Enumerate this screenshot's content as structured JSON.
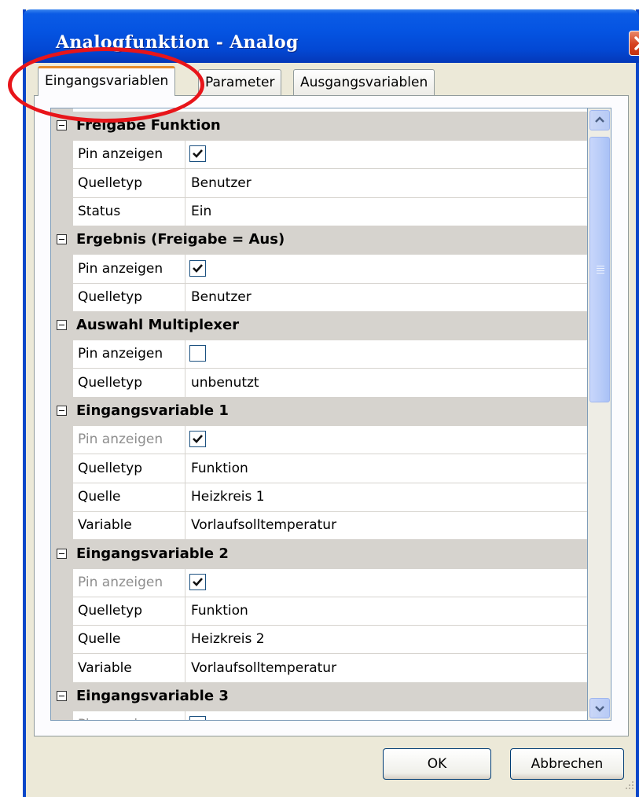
{
  "window": {
    "title": "Analogfunktion - Analog"
  },
  "tabs": [
    {
      "label": "Eingangsvariablen",
      "active": true
    },
    {
      "label": "Parameter",
      "active": false
    },
    {
      "label": "Ausgangsvariablen",
      "active": false
    }
  ],
  "grid": {
    "categories": [
      {
        "label": "Freigabe Funktion",
        "rows": [
          {
            "name": "Pin anzeigen",
            "checkbox": true,
            "checked": true
          },
          {
            "name": "Quelletyp",
            "value": "Benutzer"
          },
          {
            "name": "Status",
            "value": "Ein"
          }
        ]
      },
      {
        "label": "Ergebnis (Freigabe = Aus)",
        "rows": [
          {
            "name": "Pin anzeigen",
            "checkbox": true,
            "checked": true
          },
          {
            "name": "Quelletyp",
            "value": "Benutzer"
          }
        ]
      },
      {
        "label": "Auswahl Multiplexer",
        "rows": [
          {
            "name": "Pin anzeigen",
            "checkbox": true,
            "checked": false
          },
          {
            "name": "Quelletyp",
            "value": "unbenutzt"
          }
        ]
      },
      {
        "label": "Eingangsvariable 1",
        "rows": [
          {
            "name": "Pin anzeigen",
            "checkbox": true,
            "checked": true,
            "disabled": true
          },
          {
            "name": "Quelletyp",
            "value": "Funktion"
          },
          {
            "name": "Quelle",
            "value": "Heizkreis 1"
          },
          {
            "name": "Variable",
            "value": "Vorlaufsolltemperatur"
          }
        ]
      },
      {
        "label": "Eingangsvariable 2",
        "rows": [
          {
            "name": "Pin anzeigen",
            "checkbox": true,
            "checked": true,
            "disabled": true
          },
          {
            "name": "Quelletyp",
            "value": "Funktion"
          },
          {
            "name": "Quelle",
            "value": "Heizkreis 2"
          },
          {
            "name": "Variable",
            "value": "Vorlaufsolltemperatur"
          }
        ]
      },
      {
        "label": "Eingangsvariable 3",
        "rows": [
          {
            "name": "Pin anzeigen",
            "checkbox": true,
            "checked": true,
            "disabled": true
          }
        ]
      }
    ]
  },
  "buttons": {
    "ok": "OK",
    "cancel": "Abbrechen"
  },
  "colors": {
    "titlebar": "#0554e2",
    "highlight_ring": "#e8151a",
    "category_bg": "#d6d3ce",
    "close_button": "#d6401e"
  }
}
